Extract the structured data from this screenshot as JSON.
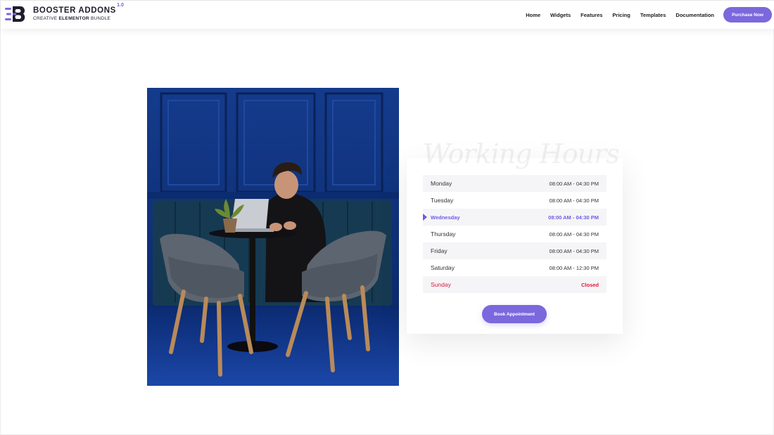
{
  "brand": {
    "title": "BOOSTER ADDONS",
    "version": "1.0",
    "subtitle_pre": "CREATIVE ",
    "subtitle_bold": "ELEMENTOR",
    "subtitle_post": " BUNDLE",
    "accent_color": "#6c5ce7",
    "dark_color": "#1e1e2e"
  },
  "nav": {
    "items": [
      "Home",
      "Widgets",
      "Features",
      "Pricing",
      "Templates",
      "Documentation"
    ],
    "cta": "Purchase Now"
  },
  "photo": {
    "subject": "man with laptop at cafe table between two grey chairs, blue panelled wall"
  },
  "working_hours": {
    "heading": "Working Hours",
    "rows": [
      {
        "day": "Monday",
        "time": "08:00 AM - 04:30 PM"
      },
      {
        "day": "Tuesday",
        "time": "08:00 AM - 04:30 PM"
      },
      {
        "day": "Wednesday",
        "time": "08:00 AM - 04:30 PM"
      },
      {
        "day": "Thursday",
        "time": "08:00 AM - 04:30 PM"
      },
      {
        "day": "Friday",
        "time": "08:00 AM - 04:30 PM"
      },
      {
        "day": "Saturday",
        "time": "08:00 AM - 12:30 PM"
      },
      {
        "day": "Sunday",
        "time": "Closed"
      }
    ],
    "highlight_color": "#6c5ce7",
    "closed_color": "#e01a3c",
    "button": "Book Appointment"
  }
}
